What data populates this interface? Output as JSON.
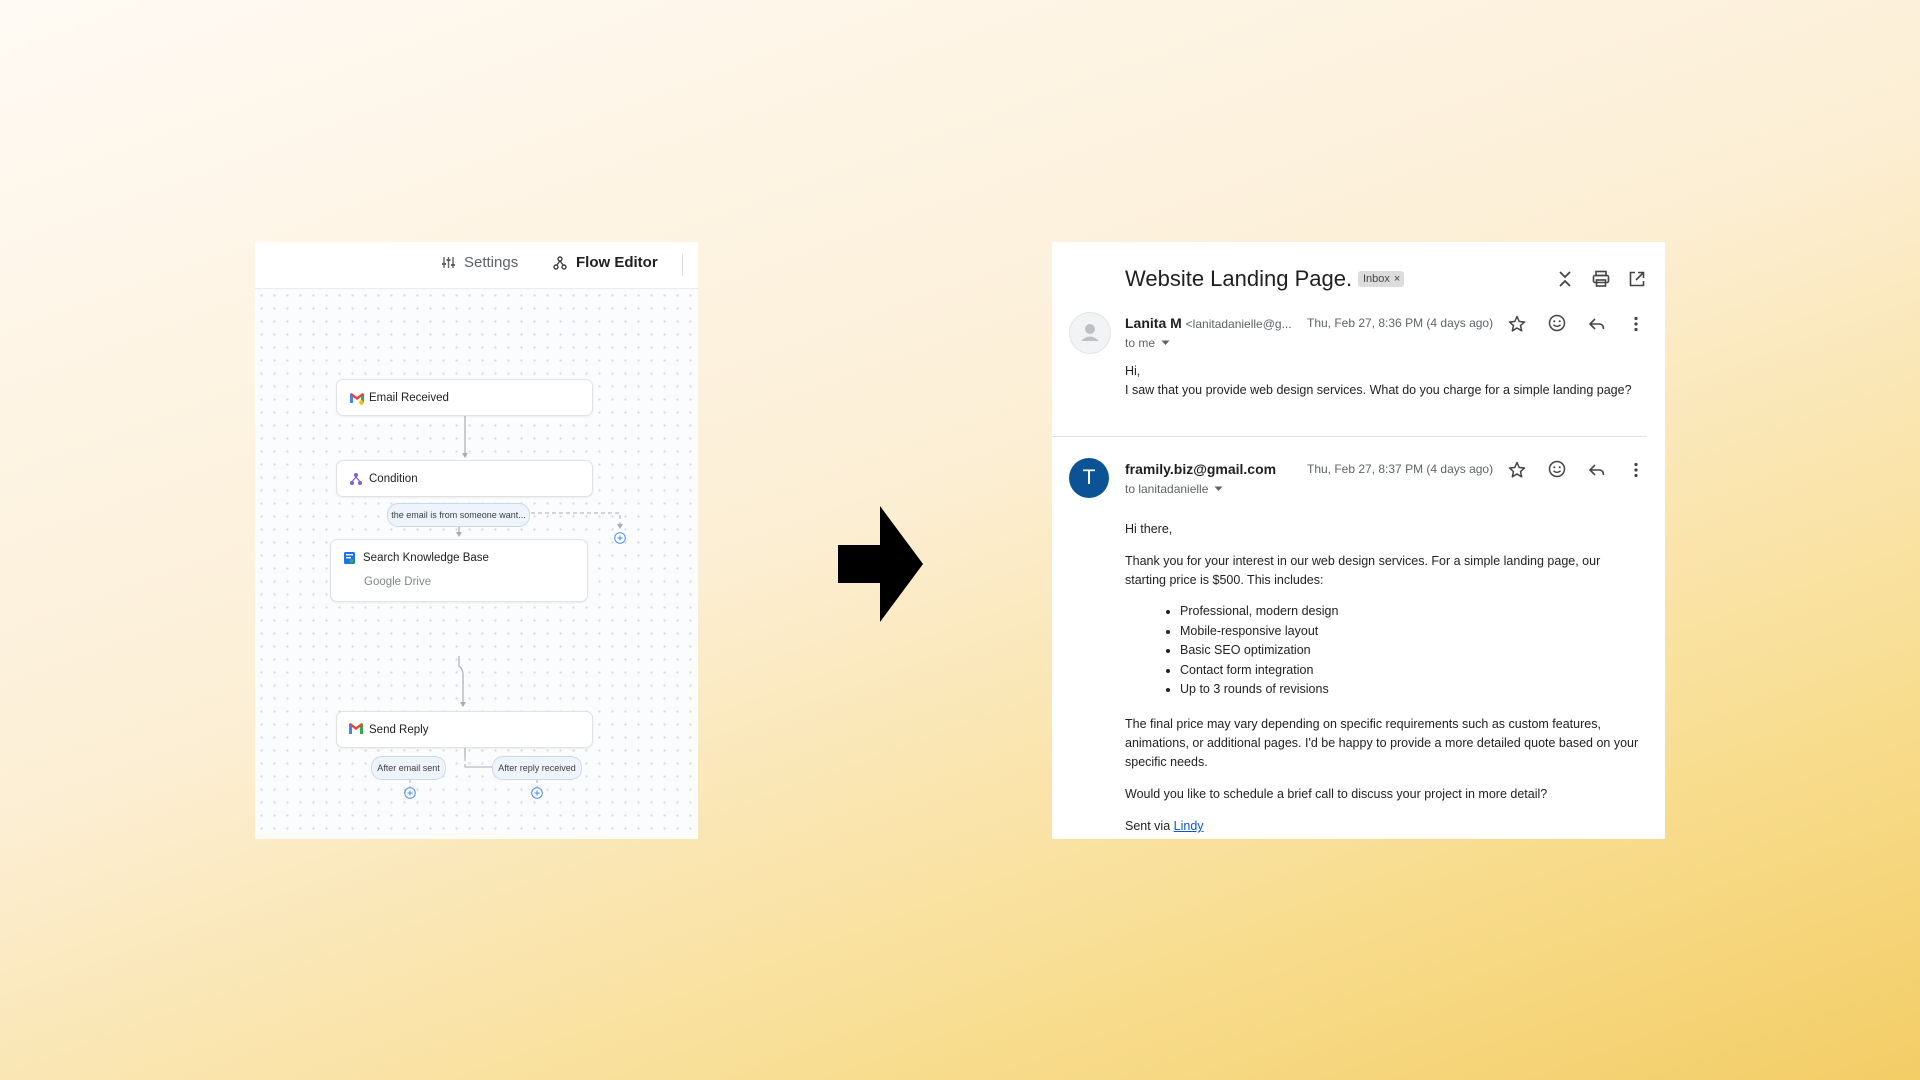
{
  "flow_editor": {
    "tabs": {
      "settings_label": "Settings",
      "flow_label": "Flow Editor"
    },
    "nodes": {
      "email_received": "Email Received",
      "condition": "Condition",
      "condition_pill": "the email is from someone want...",
      "search_kb": "Search Knowledge Base",
      "search_kb_source": "Google Drive",
      "send_reply": "Send Reply",
      "after_sent": "After email sent",
      "after_reply": "After reply received"
    },
    "icons": [
      "gmail-icon",
      "condition-icon",
      "knowledge-base-icon",
      "add-icon",
      "settings-sliders-icon",
      "flow-icon"
    ]
  },
  "email": {
    "subject": "Website Landing Page.",
    "label_chip": "Inbox",
    "label_chip_close": "×",
    "message1": {
      "sender_name": "Lanita M",
      "sender_email": "<lanitadanielle@g...",
      "date": "Thu, Feb 27, 8:36 PM (4 days ago)",
      "to": "to me",
      "greeting": "Hi,",
      "body": "I saw that you provide web design services. What do you charge for a simple landing page?"
    },
    "message2": {
      "avatar_letter": "T",
      "sender_email": "framily.biz@gmail.com",
      "date": "Thu, Feb 27, 8:37 PM (4 days ago)",
      "to": "to lanitadanielle",
      "greeting": "Hi there,",
      "intro": "Thank you for your interest in our web design services. For a simple landing page, our starting price is $500. This includes:",
      "features": [
        "Professional, modern design",
        "Mobile-responsive layout",
        "Basic SEO optimization",
        "Contact form integration",
        "Up to 3 rounds of revisions"
      ],
      "pricing_note": "The final price may vary depending on specific requirements such as custom features, animations, or additional pages. I'd be happy to provide a more detailed quote based on your specific needs.",
      "question": "Would you like to schedule a brief call to discuss your project in more detail?",
      "signature_prefix": "Sent via ",
      "signature_link": "Lindy"
    }
  },
  "colors": {
    "accent_blue": "#0b5394",
    "link": "#1155cc",
    "pill_bg": "#eef4fb"
  }
}
